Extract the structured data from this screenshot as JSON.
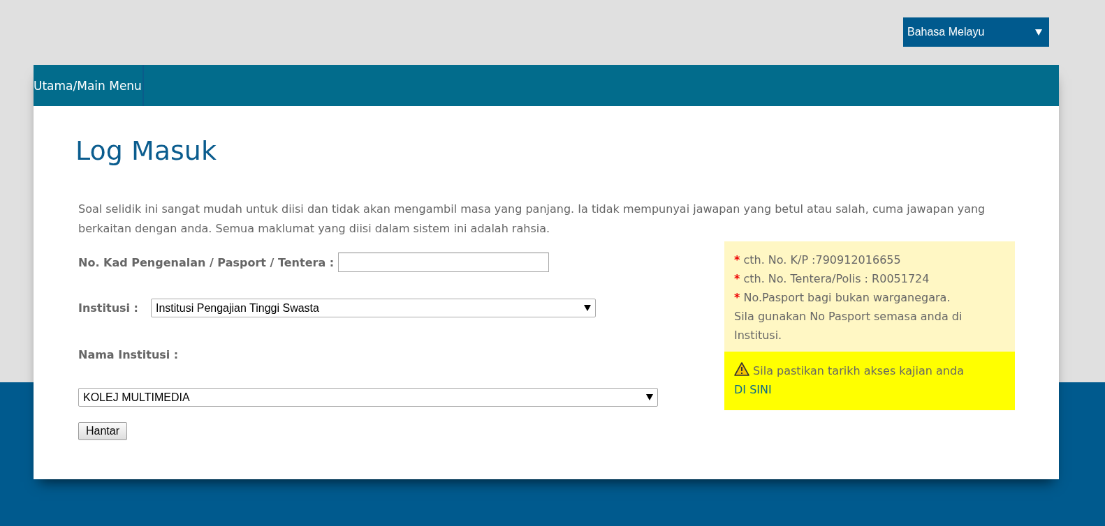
{
  "language_select": {
    "value": "Bahasa Melayu"
  },
  "nav": {
    "items": [
      {
        "label": "Utama/Main Menu"
      }
    ]
  },
  "page_title": "Log Masuk",
  "intro": "Soal selidik ini sangat mudah untuk diisi dan tidak akan mengambil masa yang panjang. Ia tidak mempunyai jawapan yang betul atau salah, cuma jawapan yang berkaitan dengan anda. Semua maklumat yang diisi dalam sistem ini adalah rahsia.",
  "form": {
    "id_field": {
      "label": "No. Kad Pengenalan / Pasport / Tentera :"
    },
    "institution_type": {
      "label": "Institusi :",
      "value": "Institusi Pengajian Tinggi Swasta"
    },
    "institution_name": {
      "label": "Nama Institusi :",
      "value": "KOLEJ MULTIMEDIA"
    },
    "submit": "Hantar"
  },
  "hints": [
    {
      "marker": "*",
      "text": "cth. No. K/P :790912016655"
    },
    {
      "marker": "*",
      "text": "cth. No. Tentera/Polis : R0051724"
    },
    {
      "marker": "*",
      "text": "No.Pasport bagi bukan warganegara."
    },
    {
      "text": "Sila gunakan No Pasport semasa anda di Institusi."
    }
  ],
  "notice": {
    "text": "Sila pastikan tarikh akses kajian anda",
    "link": "DI SINI"
  }
}
